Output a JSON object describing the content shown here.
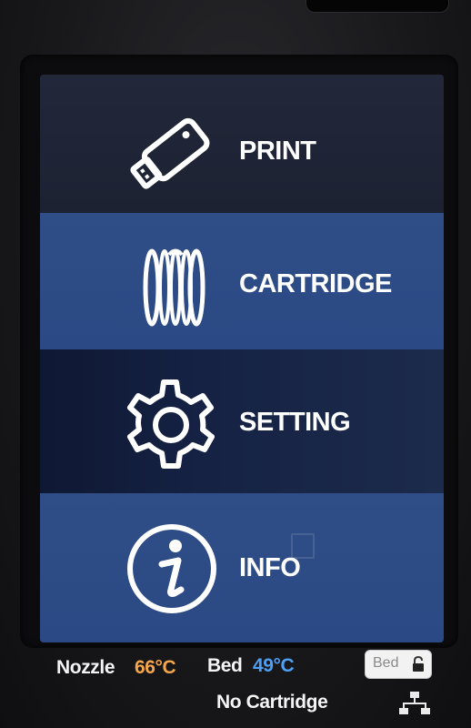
{
  "menu": {
    "print_label": "PRINT",
    "cartridge_label": "CARTRIDGE",
    "setting_label": "SETTING",
    "info_label": "INFO"
  },
  "icons": {
    "print": "usb-drive-icon",
    "cartridge": "filament-spool-icon",
    "setting": "gear-icon",
    "info": "info-circle-icon",
    "bed_button": "unlock-icon",
    "network": "network-icon"
  },
  "status": {
    "nozzle_label": "Nozzle",
    "nozzle_temp": "66°C",
    "bed_label": "Bed",
    "bed_temp": "49°C",
    "bed_button_label": "Bed",
    "cartridge_status": "No Cartridge"
  },
  "colors": {
    "nozzle_temp": "#f5a64a",
    "bed_temp": "#4f9ff5",
    "menu_blue": "#2c4a85",
    "menu_dark": "#1f2535"
  }
}
